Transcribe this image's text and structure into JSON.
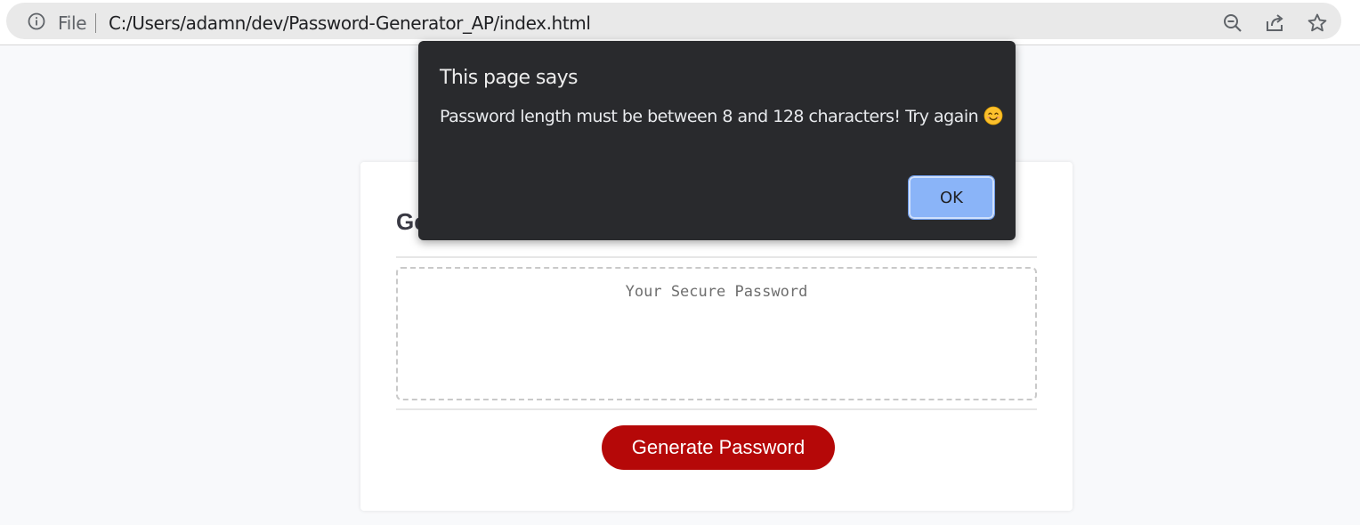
{
  "browser": {
    "scheme_label": "File",
    "url": "C:/Users/adamn/dev/Password-Generator_AP/index.html",
    "icons": [
      "info-icon",
      "zoom-out-icon",
      "share-icon",
      "bookmark-star-icon"
    ]
  },
  "card": {
    "title": "Ge",
    "password_placeholder": "Your Secure Password",
    "generate_label": "Generate Password",
    "accent_color": "#b50808"
  },
  "dialog": {
    "title": "This page says",
    "message": "Password length must be between 8 and 128 characters! Try again",
    "emoji": "smiling-face-icon",
    "ok_label": "OK",
    "button_color": "#8ab4f8"
  }
}
